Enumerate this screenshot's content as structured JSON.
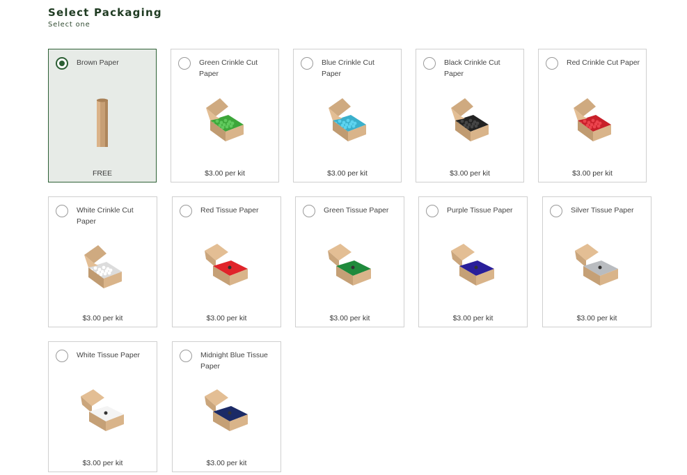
{
  "header": {
    "title": "Select Packaging",
    "subtitle": "Select one"
  },
  "options": [
    {
      "label": "Brown Paper",
      "price": "FREE",
      "selected": true,
      "fill_color": "#c79f75",
      "icon": "paper-roll-icon"
    },
    {
      "label": "Green Crinkle Cut Paper",
      "price": "$3.00 per kit",
      "selected": false,
      "fill_color": "#3da63a",
      "icon": "crinkle-box-icon"
    },
    {
      "label": "Blue Crinkle Cut Paper",
      "price": "$3.00 per kit",
      "selected": false,
      "fill_color": "#3ab0cc",
      "icon": "crinkle-box-icon"
    },
    {
      "label": "Black Crinkle Cut Paper",
      "price": "$3.00 per kit",
      "selected": false,
      "fill_color": "#222222",
      "icon": "crinkle-box-icon"
    },
    {
      "label": "Red Crinkle Cut Paper",
      "price": "$3.00 per kit",
      "selected": false,
      "fill_color": "#c8202a",
      "icon": "crinkle-box-icon"
    },
    {
      "label": "White Crinkle Cut Paper",
      "price": "$3.00 per kit",
      "selected": false,
      "fill_color": "#dcdcdc",
      "icon": "crinkle-box-icon"
    },
    {
      "label": "Red Tissue Paper",
      "price": "$3.00 per kit",
      "selected": false,
      "fill_color": "#e0242a",
      "icon": "tissue-box-icon"
    },
    {
      "label": "Green Tissue Paper",
      "price": "$3.00 per kit",
      "selected": false,
      "fill_color": "#1f8a3c",
      "icon": "tissue-box-icon"
    },
    {
      "label": "Purple Tissue Paper",
      "price": "$3.00 per kit",
      "selected": false,
      "fill_color": "#2a1f9a",
      "icon": "tissue-box-icon"
    },
    {
      "label": "Silver Tissue Paper",
      "price": "$3.00 per kit",
      "selected": false,
      "fill_color": "#b9bcc0",
      "icon": "tissue-box-icon"
    },
    {
      "label": "White Tissue Paper",
      "price": "$3.00 per kit",
      "selected": false,
      "fill_color": "#f4f4f4",
      "icon": "tissue-box-icon"
    },
    {
      "label": "Midnight Blue Tissue Paper",
      "price": "$3.00 per kit",
      "selected": false,
      "fill_color": "#1b2a66",
      "icon": "tissue-box-icon"
    }
  ],
  "colors": {
    "accent": "#2c5f34",
    "selected_bg": "#e7ebe7",
    "box_kraft": "#d9b48a"
  }
}
